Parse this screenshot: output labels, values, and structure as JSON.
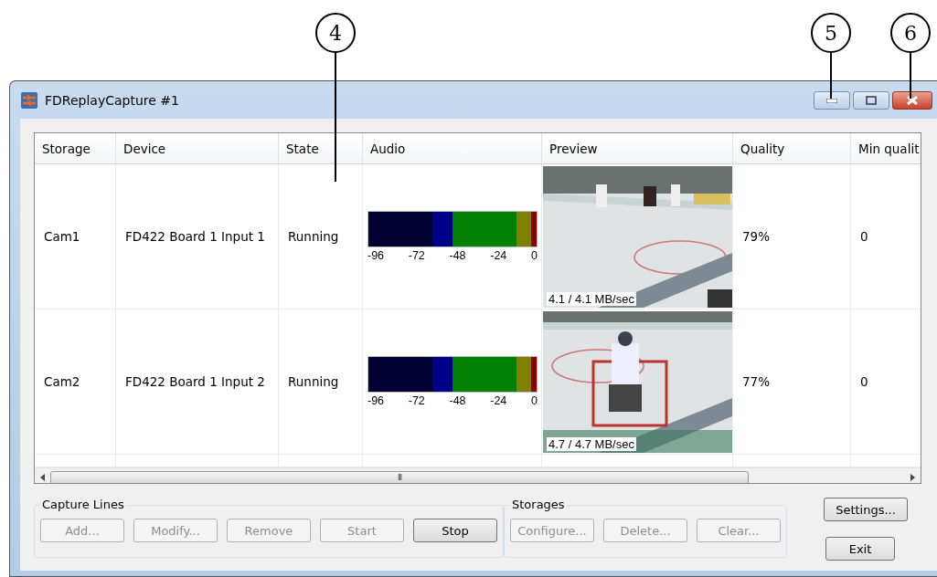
{
  "callouts": [
    {
      "label": "4"
    },
    {
      "label": "5"
    },
    {
      "label": "6"
    }
  ],
  "window": {
    "title": "FDReplayCapture #1"
  },
  "table": {
    "columns": [
      "Storage",
      "Device",
      "State",
      "Audio",
      "Preview",
      "Quality",
      "Min qualit"
    ],
    "rows": [
      {
        "storage": "Cam1",
        "device": "FD422 Board 1 Input 1",
        "state": "Running",
        "audio": {
          "level": 1,
          "ticks": [
            "-96",
            "-72",
            "-48",
            "-24",
            "0"
          ]
        },
        "preview": {
          "kind": "picture",
          "rate": "4.1 / 4.1 MB/sec"
        },
        "quality": "79%",
        "min_quality": "0"
      },
      {
        "storage": "Cam2",
        "device": "FD422 Board 1 Input 2",
        "state": "Running",
        "audio": {
          "level": 1,
          "ticks": [
            "-96",
            "-72",
            "-48",
            "-24",
            "0"
          ]
        },
        "preview": {
          "kind": "picture",
          "rate": "4.7 / 4.7 MB/sec"
        },
        "quality": "77%",
        "min_quality": "0"
      }
    ],
    "scrollbar_grip": "III"
  },
  "groups": [
    {
      "title": "Capture Lines",
      "buttons": [
        {
          "label": "Add...",
          "disabled": true
        },
        {
          "label": "Modify...",
          "disabled": true
        },
        {
          "label": "Remove",
          "disabled": true
        },
        {
          "label": "Start",
          "disabled": true
        },
        {
          "label": "Stop",
          "disabled": false
        }
      ]
    },
    {
      "title": "Storages",
      "buttons": [
        {
          "label": "Configure...",
          "disabled": true
        },
        {
          "label": "Delete...",
          "disabled": true
        },
        {
          "label": "Clear...",
          "disabled": true
        }
      ]
    }
  ],
  "side_buttons": [
    {
      "label": "Settings...",
      "disabled": false
    },
    {
      "label": "Exit",
      "disabled": false
    }
  ]
}
